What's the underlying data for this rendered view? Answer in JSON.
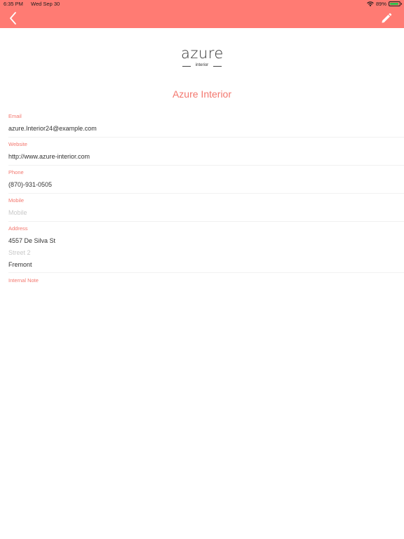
{
  "status_bar": {
    "time": "6:35 PM",
    "date": "Wed Sep 30",
    "battery_percent": "89%",
    "battery_level": 0.89,
    "icons": [
      "wifi-icon",
      "battery-icon"
    ]
  },
  "nav": {
    "back_icon": "chevron-left-icon",
    "edit_icon": "pencil-icon",
    "bar_color": "#ff7b73"
  },
  "logo": {
    "word": "azure",
    "tagline": "interior"
  },
  "contact": {
    "name": "Azure Interior",
    "email_label": "Email",
    "email": "azure.Interior24@example.com",
    "website_label": "Website",
    "website": "http://www.azure-interior.com",
    "phone_label": "Phone",
    "phone": "(870)-931-0505",
    "mobile_label": "Mobile",
    "mobile_placeholder": "Mobile",
    "address_label": "Address",
    "street": "4557 De Silva St",
    "street2_placeholder": "Street 2",
    "city": "Fremont",
    "internal_note_label": "Internal Note"
  },
  "colors": {
    "accent": "#f3776e",
    "text": "#333333",
    "placeholder": "#c8c8c8"
  }
}
